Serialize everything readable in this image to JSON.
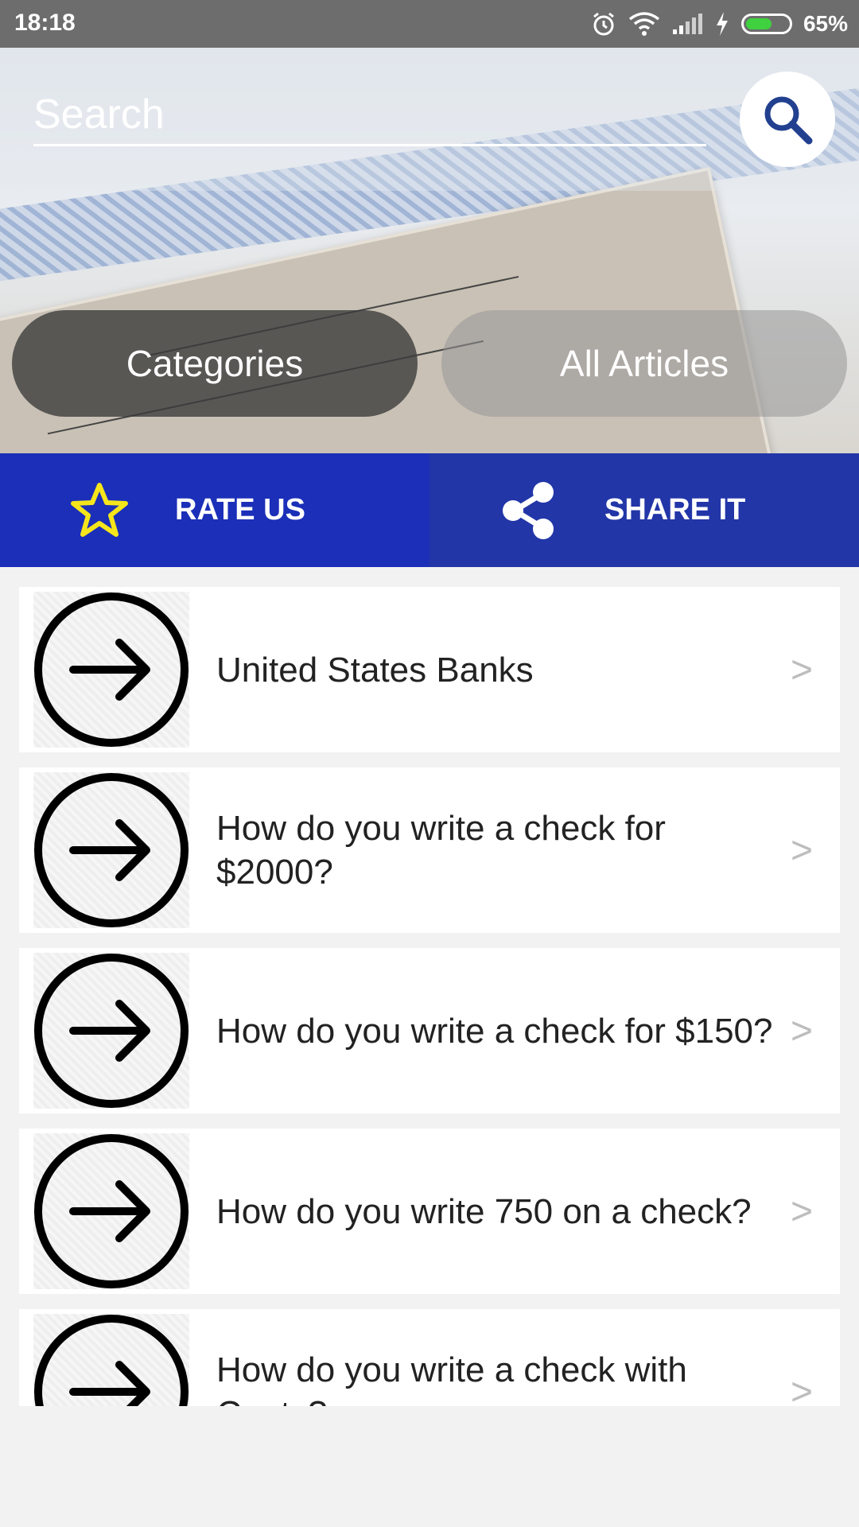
{
  "status_bar": {
    "time": "18:18",
    "battery_percent": "65%",
    "battery_level": 0.65,
    "icons": [
      "alarm-icon",
      "wifi-icon",
      "signal-icon",
      "charging-icon",
      "battery-icon"
    ]
  },
  "search": {
    "placeholder": "Search",
    "button_icon": "search-icon"
  },
  "hero": {
    "categories_label": "Categories",
    "all_articles_label": "All Articles"
  },
  "actions": {
    "rate_label": "RATE US",
    "rate_icon": "star-icon",
    "share_label": "SHARE IT",
    "share_icon": "share-icon"
  },
  "list": {
    "items": [
      {
        "title": "United States Banks",
        "icon": "arrow-circle-icon",
        "chevron": ">"
      },
      {
        "title": "How do you write a check for $2000?",
        "icon": "arrow-circle-icon",
        "chevron": ">"
      },
      {
        "title": "How do you write a check for $150?",
        "icon": "arrow-circle-icon",
        "chevron": ">"
      },
      {
        "title": "How do you write 750 on a check?",
        "icon": "arrow-circle-icon",
        "chevron": ">"
      },
      {
        "title": "How do you write a check with Cents?",
        "icon": "arrow-circle-icon",
        "chevron": ">"
      }
    ]
  },
  "colors": {
    "rate_bg": "#1b2fb8",
    "share_bg": "#2236a8",
    "status_bar": "#6d6d6d",
    "star": "#f5e51b",
    "search_icon": "#22408f"
  }
}
